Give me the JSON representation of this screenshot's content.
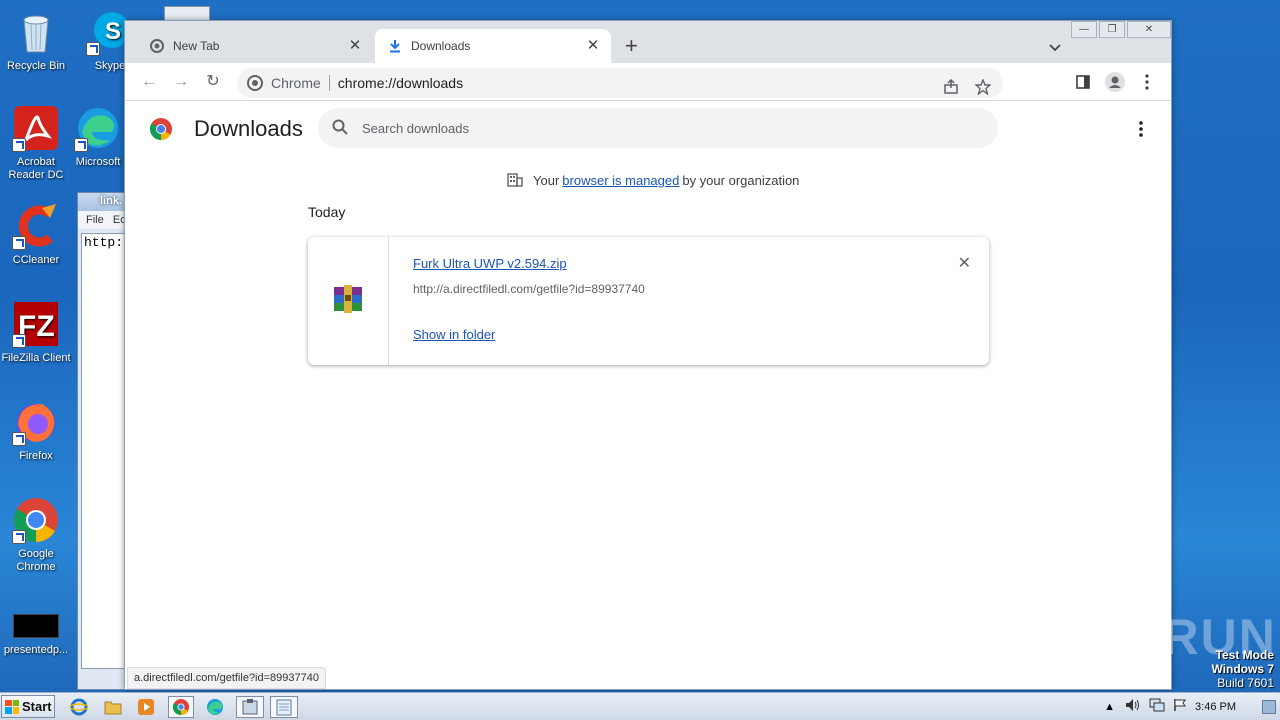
{
  "desktop": {
    "icons": [
      {
        "label": "Recycle Bin"
      },
      {
        "label": "Skype"
      },
      {
        "label": "Acrobat Reader DC"
      },
      {
        "label": "Microsoft"
      },
      {
        "label": "CCleaner"
      },
      {
        "label": "FileZilla Client"
      },
      {
        "label": "Firefox"
      },
      {
        "label": "Google Chrome"
      },
      {
        "label": "presentedp..."
      }
    ]
  },
  "notepad": {
    "title": "link.",
    "menu_file": "File",
    "menu_edit": "Ec",
    "content": "http:"
  },
  "browser": {
    "tabs": [
      {
        "label": "New Tab",
        "icon": "chrome-icon"
      },
      {
        "label": "Downloads",
        "icon": "download-icon"
      }
    ],
    "omnibox": {
      "chip": "Chrome",
      "url": "chrome://downloads"
    },
    "page": {
      "title": "Downloads",
      "search_placeholder": "Search downloads",
      "managed_prefix": "Your",
      "managed_link": "browser is managed",
      "managed_suffix": "by your organization",
      "section": "Today",
      "download": {
        "filename": "Furk Ultra UWP v2.594.zip",
        "source_url": "http://a.directfiledl.com/getfile?id=89937740",
        "action": "Show in folder"
      }
    },
    "status_url": "a.directfiledl.com/getfile?id=89937740"
  },
  "watermark": "ANY RUN",
  "test_mode": {
    "line1": "Test Mode",
    "line2": "Windows 7",
    "line3": "Build 7601"
  },
  "taskbar": {
    "start_label": "Start",
    "clock": "3:46 PM"
  },
  "colors": {
    "link": "#1a55b7",
    "chrome_red": "#db4437",
    "chrome_green": "#0f9d58",
    "chrome_yellow": "#f4b400",
    "chrome_blue": "#4285f4"
  }
}
